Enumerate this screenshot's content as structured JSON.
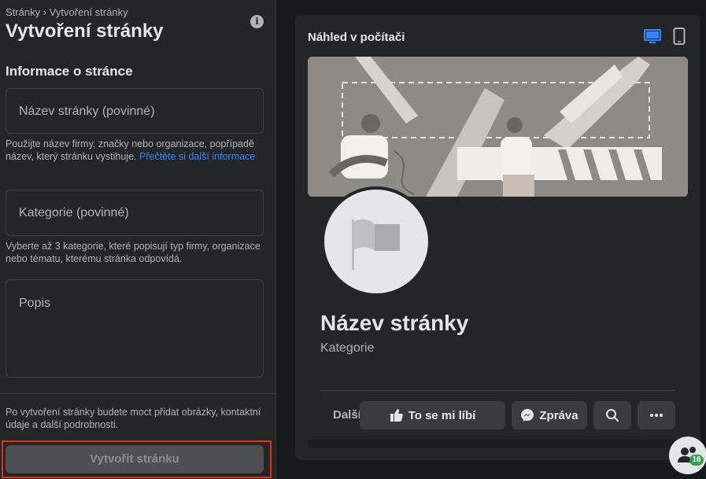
{
  "breadcrumb": "Stránky › Vytvoření stránky",
  "title": "Vytvoření stránky",
  "section_title": "Informace o stránce",
  "fields": {
    "name_placeholder": "Název stránky (povinné)",
    "name_help": "Použijte název firmy, značky nebo organizace, popřípadě název, který stránku vystihuje.",
    "name_help_link": "Přečtěte si další informace",
    "category_placeholder": "Kategorie (povinné)",
    "category_help": "Vyberte až 3 kategorie, které popisují typ firmy, organizace nebo tématu, kterému stránka odpovídá.",
    "description_placeholder": "Popis"
  },
  "footer_note": "Po vytvoření stránky budete moct přidat obrázky, kontaktní údaje a další podrobnosti.",
  "create_button": "Vytvořit stránku",
  "preview": {
    "title": "Náhled v počítači",
    "page_name": "Název stránky",
    "category": "Kategorie",
    "more_tab": "Další",
    "like_button": "To se mi líbí",
    "message_button": "Zpráva",
    "accent": "#2d88ff"
  },
  "fab_badge": "16"
}
